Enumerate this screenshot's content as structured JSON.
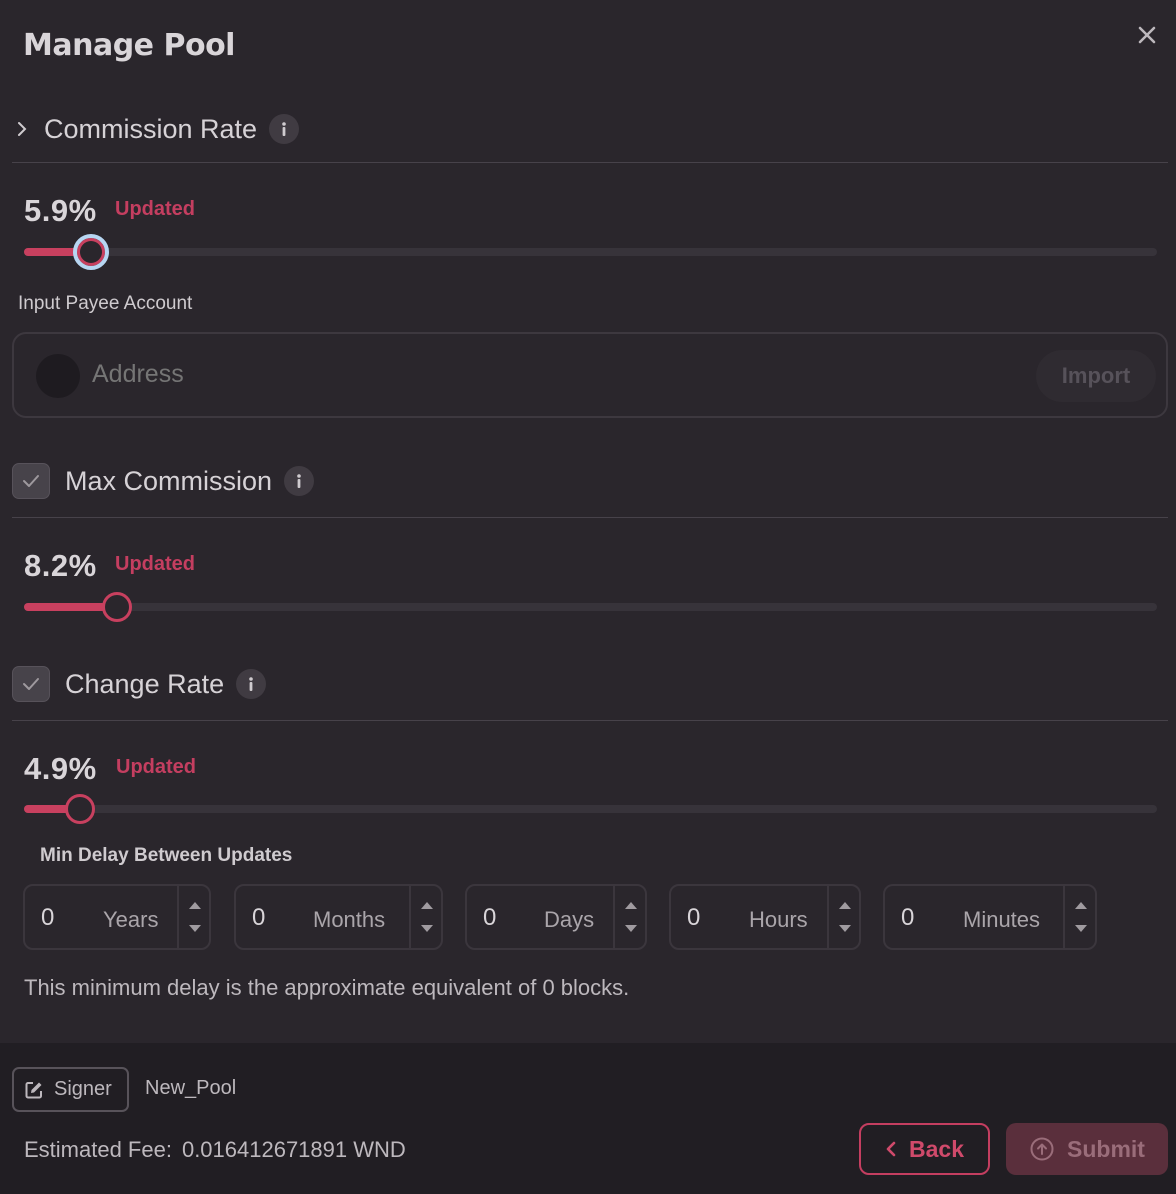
{
  "header": {
    "title": "Manage Pool",
    "close_icon": "close-icon"
  },
  "commission_rate": {
    "title": "Commission Rate",
    "value_text": "5.9%",
    "status": "Updated",
    "slider_fraction": 0.059
  },
  "payee": {
    "label": "Input Payee Account",
    "placeholder": "Address",
    "import_label": "Import"
  },
  "max_commission": {
    "title": "Max Commission",
    "checked": true,
    "value_text": "8.2%",
    "status": "Updated",
    "slider_fraction": 0.082
  },
  "change_rate": {
    "title": "Change Rate",
    "checked": true,
    "value_text": "4.9%",
    "status": "Updated",
    "slider_fraction": 0.049,
    "min_delay_label": "Min Delay Between Updates",
    "delays": [
      {
        "value": "0",
        "unit": "Years"
      },
      {
        "value": "0",
        "unit": "Months"
      },
      {
        "value": "0",
        "unit": "Days"
      },
      {
        "value": "0",
        "unit": "Hours"
      },
      {
        "value": "0",
        "unit": "Minutes"
      }
    ],
    "note": "This minimum delay is the approximate equivalent of 0 blocks."
  },
  "footer": {
    "signer_label": "Signer",
    "signer_name": "New_Pool",
    "fee_label": "Estimated Fee:",
    "fee_value": "0.016412671891 WND",
    "back_label": "Back",
    "submit_label": "Submit"
  },
  "colors": {
    "accent": "#c8405f",
    "background": "#2a262c",
    "footer": "#211e23",
    "focus_ring": "#b7d6f2"
  }
}
